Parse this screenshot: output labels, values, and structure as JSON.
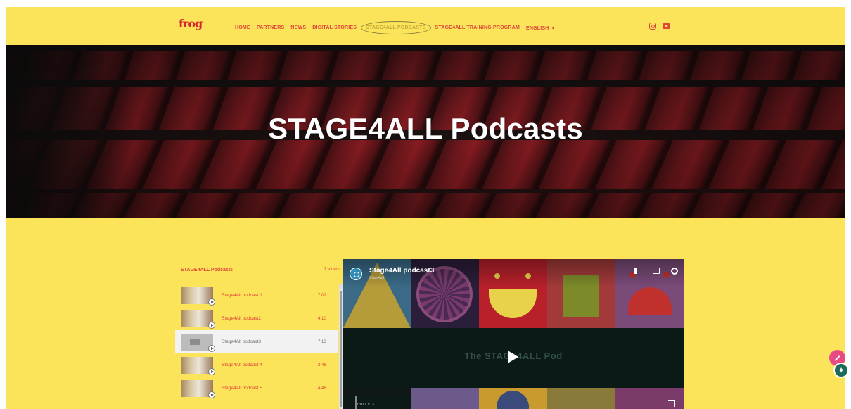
{
  "header": {
    "logo_text": "frog",
    "nav": [
      {
        "label": "HOME"
      },
      {
        "label": "PARTNERS"
      },
      {
        "label": "NEWS"
      },
      {
        "label": "DIGITAL STORIES"
      },
      {
        "label": "STAGE4ALL PODCASTS",
        "active": true
      },
      {
        "label": "STAGE4ALL TRAINING PROGRAM"
      },
      {
        "label": "ENGLISH",
        "dropdown": true
      }
    ],
    "social_icons": [
      "instagram-icon",
      "youtube-icon"
    ]
  },
  "hero": {
    "title": "STAGE4ALL Podcasts"
  },
  "playlist": {
    "title": "STAGE4ALL Podcasts",
    "count": "7 Videos",
    "items": [
      {
        "title": "Stage4All podcast 1",
        "duration": "7:02",
        "active": false
      },
      {
        "title": "Stage4All podcast2",
        "duration": "4:10",
        "active": false
      },
      {
        "title": "Stage4All podcast3",
        "duration": "7:13",
        "active": true
      },
      {
        "title": "Stage4All podcast 4",
        "duration": "2:46",
        "active": false
      },
      {
        "title": "Stage4All podcast 5",
        "duration": "4:46",
        "active": false
      }
    ]
  },
  "video": {
    "title": "Stage4All podcast3",
    "channel": "Stage4all",
    "overlay_text": "The STAGE4ALL Pod",
    "time": "0:01 / 7:13",
    "controls": [
      "volume-icon",
      "captions-icon",
      "settings-icon"
    ]
  },
  "colors": {
    "background": "#fbe35a",
    "accent": "#e0453a"
  }
}
